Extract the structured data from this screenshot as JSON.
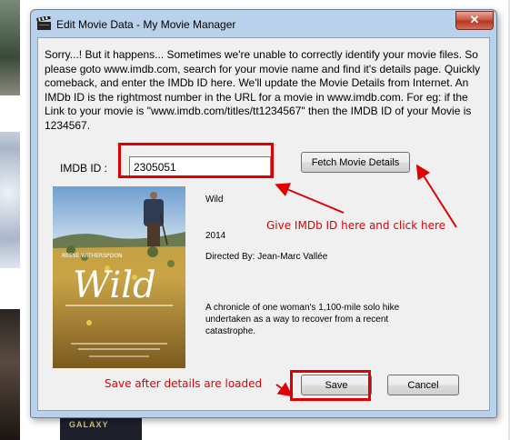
{
  "window": {
    "title": "Edit Movie Data - My Movie Manager",
    "close_glyph": "✕"
  },
  "intro_text": "Sorry...! But it happens... Sometimes we're unable to correctly identify your movie files. So please goto www.imdb.com, search for your movie name and find it's details page. Quickly comeback, and enter the IMDb ID here. We'll update the Movie Details from Internet. An IMDb ID is the rightmost number in the URL for a movie in www.imdb.com. For eg: if the Link to your movie is \"www.imdb.com/titles/tt1234567\" then the IMDB ID of your Movie is 1234567.",
  "imdb": {
    "label": "IMDB ID :",
    "value": "2305051"
  },
  "buttons": {
    "fetch": "Fetch Movie Details",
    "save": "Save",
    "cancel": "Cancel"
  },
  "movie": {
    "poster_title": "Wild",
    "title": "Wild",
    "year": "2014",
    "director": "Directed By: Jean-Marc Vallée",
    "plot": "A chronicle of one woman's 1,100-mile solo hike undertaken as a way to recover from a recent catastrophe."
  },
  "annotations": {
    "fetch_note": "Give IMDb ID here and click here",
    "save_note": "Save after details are loaded"
  },
  "background": {
    "bottom_thumb_text": "GALAXY"
  },
  "colors": {
    "annotation": "#e00000",
    "window_frame": "#b9d1ea",
    "client_bg": "#f0f0f0"
  }
}
